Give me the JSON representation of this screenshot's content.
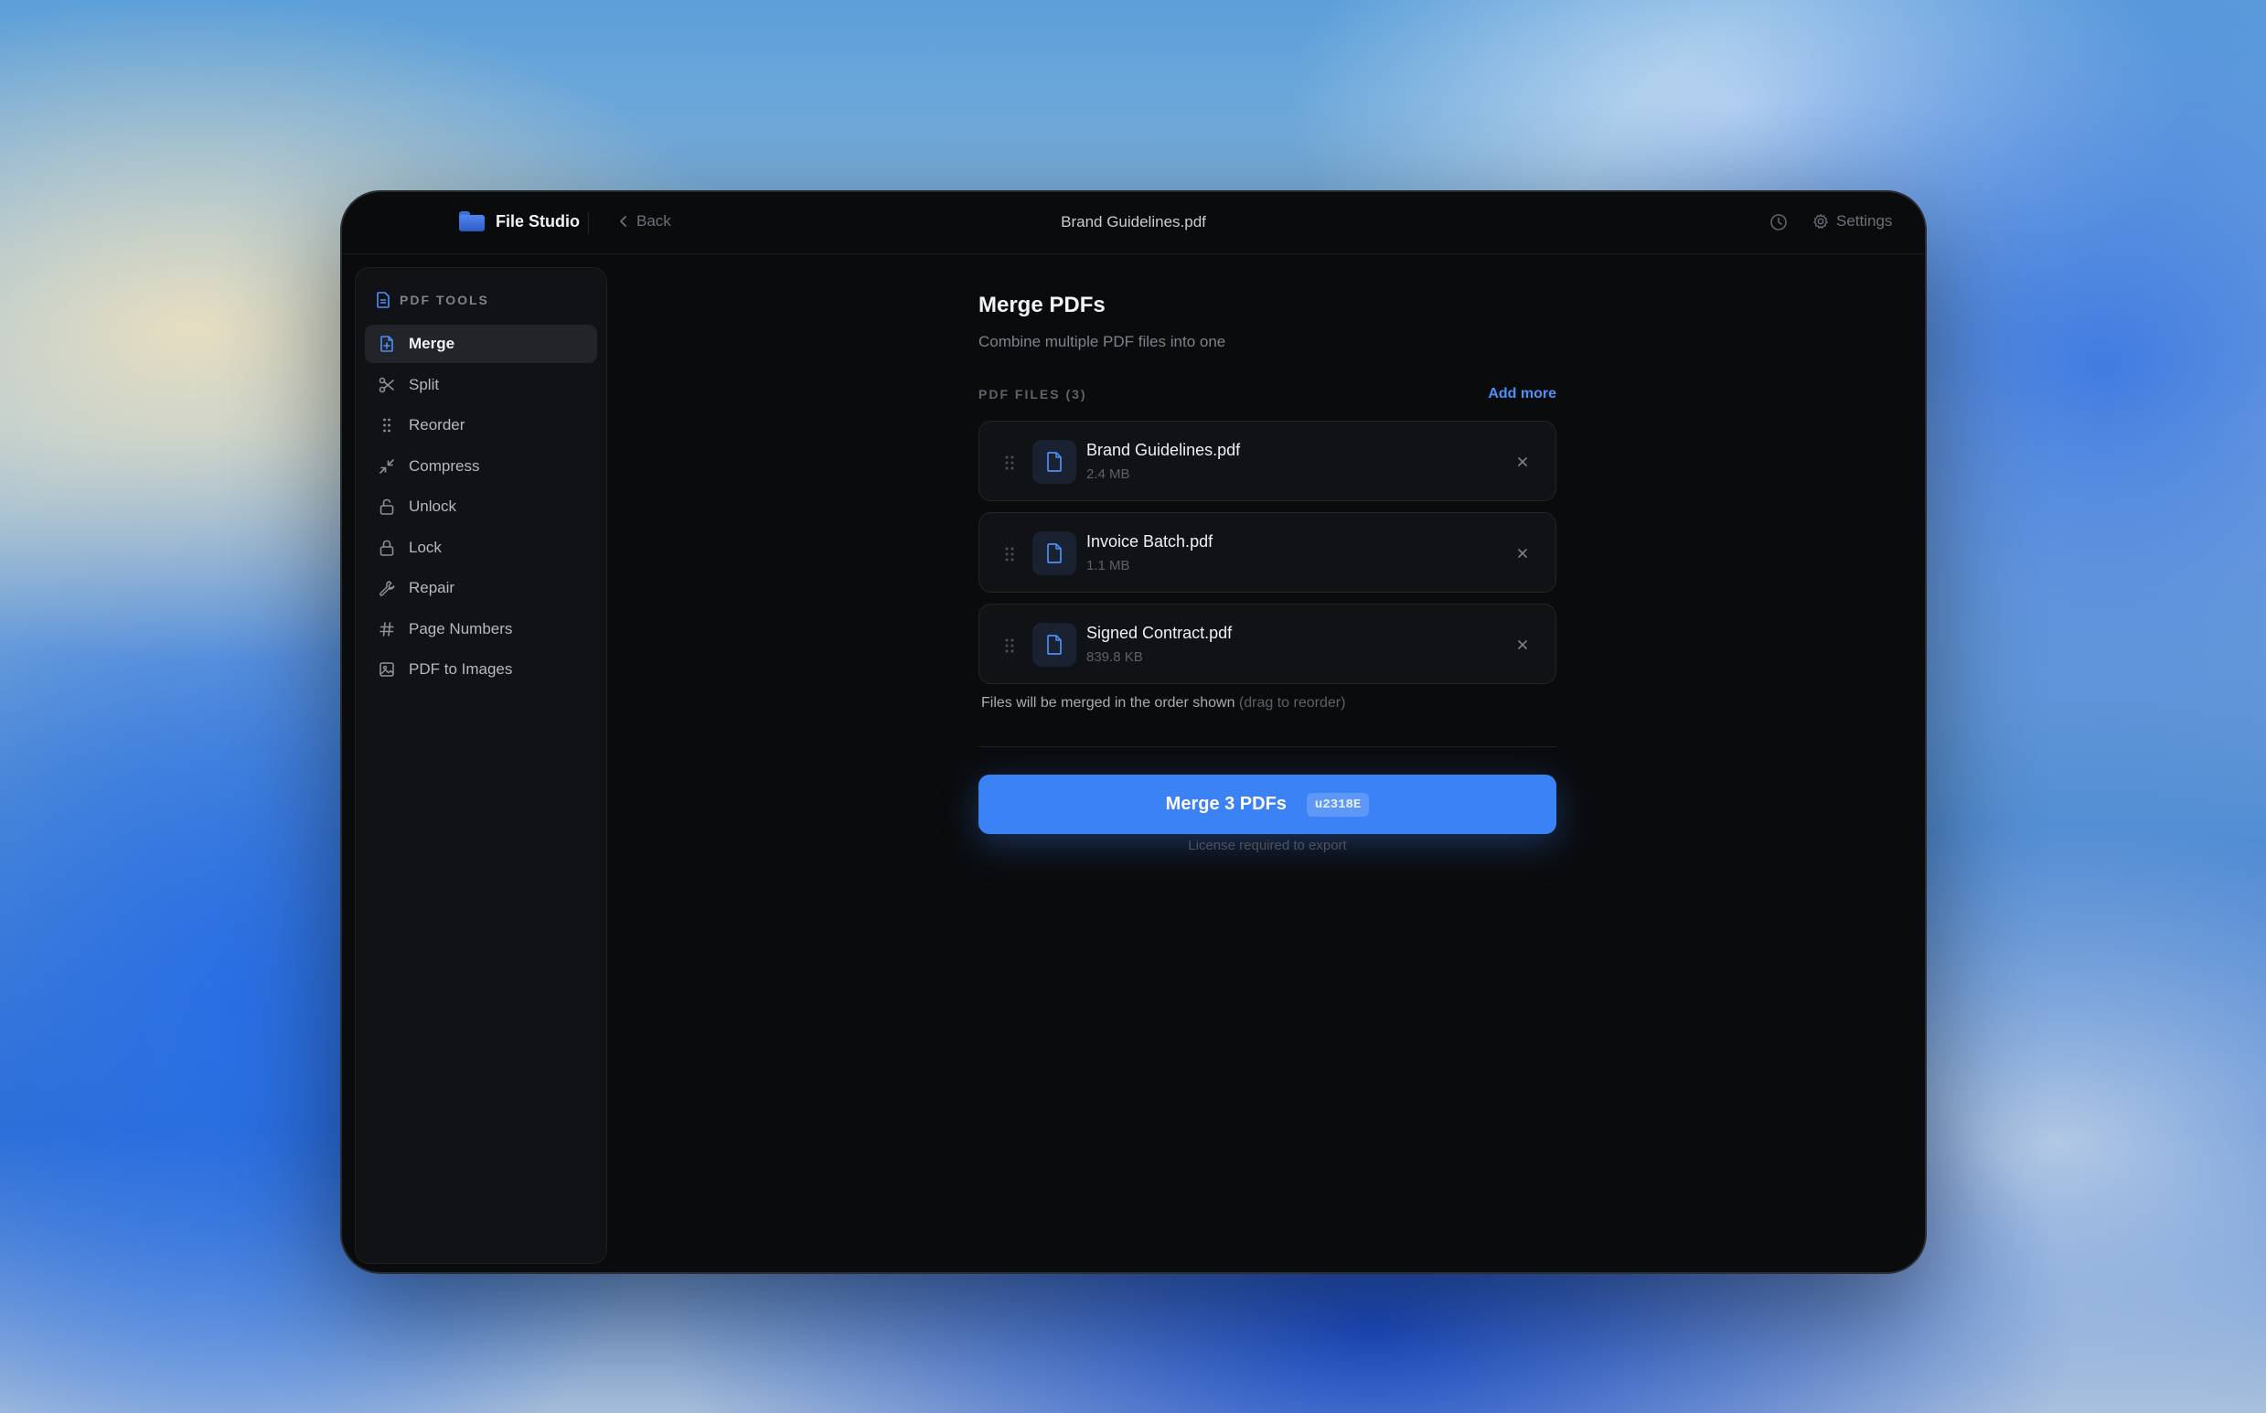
{
  "app": {
    "name": "File Studio",
    "back_label": "Back",
    "document_title": "Brand Guidelines.pdf",
    "settings_label": "Settings"
  },
  "sidebar": {
    "section_title": "PDF TOOLS",
    "items": [
      {
        "label": "Merge",
        "icon": "file-merge-icon",
        "active": true
      },
      {
        "label": "Split",
        "icon": "scissors-icon"
      },
      {
        "label": "Reorder",
        "icon": "grip-icon"
      },
      {
        "label": "Compress",
        "icon": "minimize-icon"
      },
      {
        "label": "Unlock",
        "icon": "unlock-icon"
      },
      {
        "label": "Lock",
        "icon": "lock-icon"
      },
      {
        "label": "Repair",
        "icon": "wrench-icon"
      },
      {
        "label": "Page Numbers",
        "icon": "hash-icon"
      },
      {
        "label": "PDF to Images",
        "icon": "image-icon"
      }
    ]
  },
  "main": {
    "title": "Merge PDFs",
    "subtitle": "Combine multiple PDF files into one",
    "files_label": "PDF FILES (3)",
    "add_more": "Add more",
    "files": [
      {
        "name": "Brand Guidelines.pdf",
        "size": "2.4 MB"
      },
      {
        "name": "Invoice Batch.pdf",
        "size": "1.1 MB"
      },
      {
        "name": "Signed Contract.pdf",
        "size": "839.8 KB"
      }
    ],
    "order_note": "Files will be merged in the order shown",
    "order_hint": "(drag to reorder)",
    "merge_button": "Merge 3 PDFs",
    "shortcut": "u2318E",
    "license_note": "License required to export"
  },
  "colors": {
    "accent": "#3b82f6",
    "link": "#4e8ff5",
    "window_bg": "#0a0b0d",
    "sidebar_bg": "#111215"
  }
}
